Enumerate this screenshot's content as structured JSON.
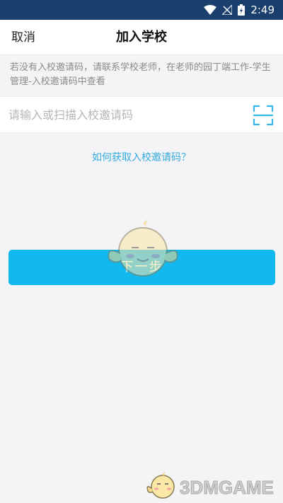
{
  "status_bar": {
    "time": "2:49",
    "icons": [
      "wifi-icon",
      "signal-off-icon",
      "battery-charging-icon"
    ]
  },
  "header": {
    "cancel_label": "取消",
    "title": "加入学校"
  },
  "tip": {
    "text": "若没有入校邀请码，请联系学校老师，在老师的园丁端工作-学生管理-入校邀请码中查看"
  },
  "invite_input": {
    "placeholder": "请输入或扫描入校邀请码",
    "value": "",
    "scan_icon": "scan-icon"
  },
  "help_link": {
    "label": "如何获取入校邀请码？"
  },
  "next_button": {
    "label": "下一步"
  },
  "watermark": {
    "text": "3DMGAME"
  },
  "colors": {
    "status_bar": "#1a3f6c",
    "accent": "#12b8f0",
    "link": "#33aadf",
    "background": "#f4f4f6"
  }
}
